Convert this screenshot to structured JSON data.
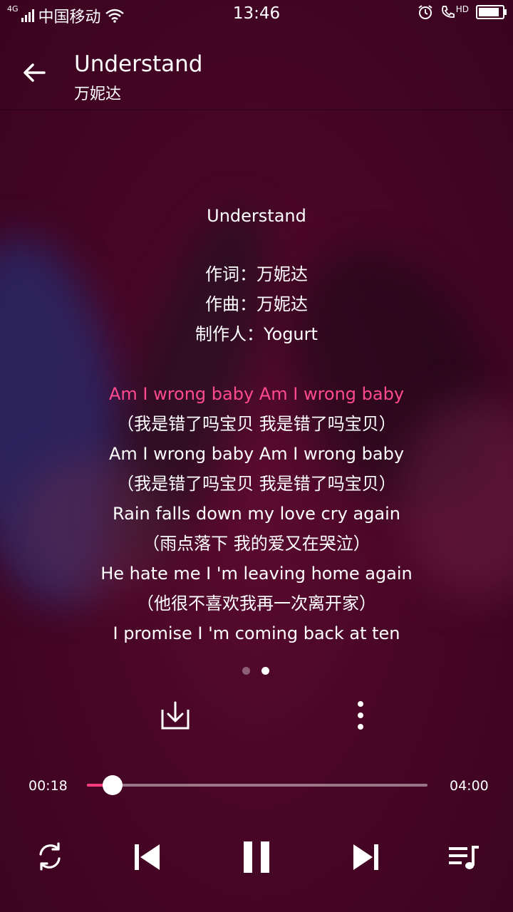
{
  "status_bar": {
    "network": "4G",
    "carrier": "中国移动",
    "time": "13:46",
    "hd": "HD",
    "battery_level": 0.9
  },
  "header": {
    "title": "Understand",
    "artist": "万妮达"
  },
  "lyrics": {
    "song_title": "Understand",
    "credits": [
      "作词：万妮达",
      "作曲：万妮达",
      "制作人：Yogurt"
    ],
    "lines": [
      {
        "text": "Am I wrong baby Am I wrong baby",
        "current": true
      },
      {
        "text": "（我是错了吗宝贝 我是错了吗宝贝）",
        "current": false
      },
      {
        "text": "Am I wrong baby Am I wrong baby",
        "current": false
      },
      {
        "text": "（我是错了吗宝贝 我是错了吗宝贝）",
        "current": false
      },
      {
        "text": "Rain falls down my love cry again",
        "current": false
      },
      {
        "text": "（雨点落下 我的爱又在哭泣）",
        "current": false
      },
      {
        "text": "He hate me I 'm leaving home again",
        "current": false
      },
      {
        "text": "（他很不喜欢我再一次离开家）",
        "current": false
      },
      {
        "text": "I promise I 'm coming back at ten",
        "current": false
      }
    ]
  },
  "pager": {
    "count": 2,
    "active_index": 1
  },
  "player": {
    "elapsed": "00:18",
    "duration": "04:00",
    "progress": 0.075
  },
  "colors": {
    "accent": "#ff3d7e",
    "background": "#3d0322"
  },
  "icons": {
    "back": "arrow-left-icon",
    "download": "download-icon",
    "more": "more-vertical-icon",
    "repeat": "repeat-icon",
    "previous": "skip-previous-icon",
    "pause": "pause-icon",
    "next": "skip-next-icon",
    "playlist": "playlist-icon"
  }
}
